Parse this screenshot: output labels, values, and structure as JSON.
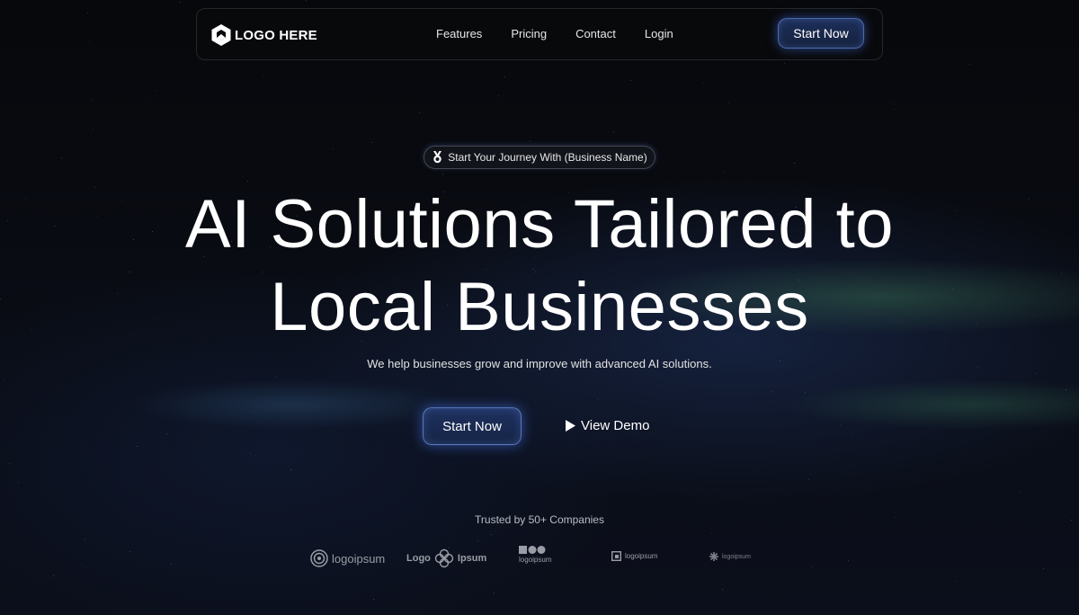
{
  "nav": {
    "logo_text": "LOGO HERE",
    "links": [
      "Features",
      "Pricing",
      "Contact",
      "Login"
    ],
    "cta_label": "Start Now"
  },
  "hero": {
    "badge_text": "Start Your Journey With (Business Name)",
    "headline_line1": "AI Solutions Tailored to",
    "headline_line2": "Local Businesses",
    "subtext": "We help businesses grow and improve with advanced AI solutions.",
    "primary_cta": "Start Now",
    "secondary_cta": "View Demo"
  },
  "trusted": {
    "label": "Trusted by 50+ Companies",
    "logos": [
      {
        "text": "logoipsum",
        "icon": "spiral-logo-icon"
      },
      {
        "text_left": "Logo",
        "text_right": "Ipsum",
        "icon": "flower-logo-icon"
      },
      {
        "text": "logoipsum",
        "icon": "squares-circles-logo-icon"
      },
      {
        "text": "logoipsum",
        "icon": "box-logo-icon"
      },
      {
        "text": "logoipsum",
        "icon": "asterisk-logo-icon"
      }
    ]
  },
  "colors": {
    "background": "#08090d",
    "accent_blue": "#1e3160",
    "glow": "#4678f0"
  }
}
